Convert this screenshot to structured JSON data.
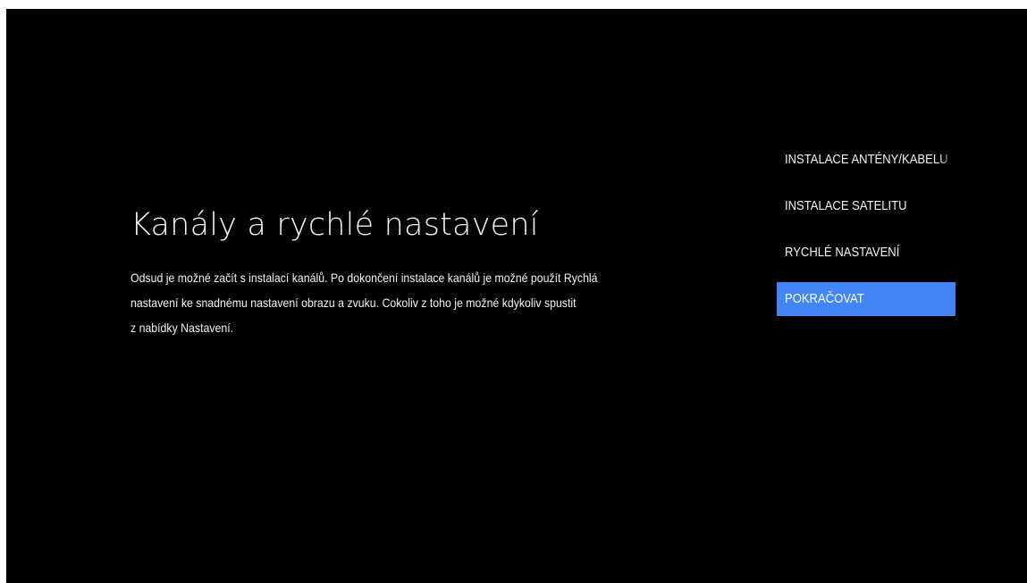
{
  "screen": {
    "title": "Kanály a rychlé nastavení",
    "description_lines": [
      "Odsud je možné začít s instalací kanálů. Po dokončení instalace kanálů je možné použít Rychlá",
      "nastavení ke snadnému nastavení obrazu a zvuku. Cokoliv z toho je možné kdykoliv spustit",
      "z nabídky Nastavení."
    ]
  },
  "menu": {
    "items": [
      {
        "label": "INSTALACE ANTÉNY/KABELU"
      },
      {
        "label": "INSTALACE SATELITU"
      },
      {
        "label": "RYCHLÉ NASTAVENÍ"
      },
      {
        "label": "POKRAČOVAT"
      }
    ],
    "selected_index": 3,
    "accent_color": "#4285f4"
  }
}
